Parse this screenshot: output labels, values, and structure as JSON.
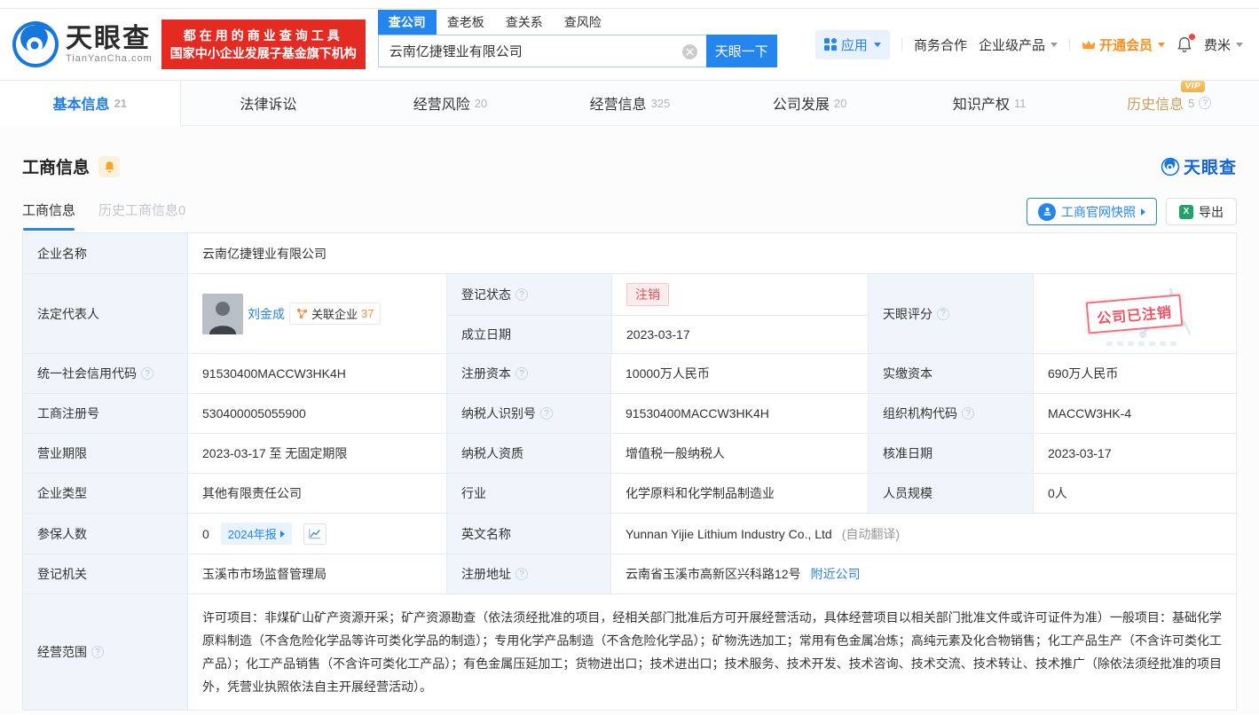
{
  "header": {
    "brand": "天眼查",
    "brand_domain": "TianYanCha.com",
    "slogan_line1": "都在用的商业查询工具",
    "slogan_line2": "国家中小企业发展子基金旗下机构",
    "search_tabs": [
      {
        "label": "查公司"
      },
      {
        "label": "查老板"
      },
      {
        "label": "查关系"
      },
      {
        "label": "查风险"
      }
    ],
    "search_value": "云南亿捷锂业有限公司",
    "search_button": "天眼一下",
    "nav_apps": "应用",
    "nav_cooperation": "商务合作",
    "nav_enterprise": "企业级产品",
    "nav_vip": "开通会员",
    "nav_user": "费米"
  },
  "tabs": [
    {
      "label": "基本信息",
      "count": "21"
    },
    {
      "label": "法律诉讼",
      "count": ""
    },
    {
      "label": "经营风险",
      "count": "20"
    },
    {
      "label": "经营信息",
      "count": "325"
    },
    {
      "label": "公司发展",
      "count": "20"
    },
    {
      "label": "知识产权",
      "count": "11"
    },
    {
      "label": "历史信息",
      "count": "5",
      "vip": "VIP"
    }
  ],
  "section": {
    "title": "工商信息",
    "subtab_current": "工商信息",
    "subtab_history": "历史工商信息0",
    "brand_watermark": "天眼查",
    "snapshot_button": "工商官网快照",
    "export_button": "导出"
  },
  "company": {
    "name_label": "企业名称",
    "name": "云南亿捷锂业有限公司",
    "legal_rep_label": "法定代表人",
    "legal_rep": "刘金成",
    "related_label": "关联企业",
    "related_count": "37",
    "status_label": "登记状态",
    "status": "注销",
    "established_label": "成立日期",
    "established": "2023-03-17",
    "score_label": "天眼评分",
    "stamp": "公司已注销"
  },
  "rows": [
    {
      "l1": "统一社会信用代码",
      "v1": "91530400MACCW3HK4H",
      "l2": "注册资本",
      "v2": "10000万人民币",
      "l3": "实缴资本",
      "v3": "690万人民币"
    },
    {
      "l1": "工商注册号",
      "v1": "530400005055900",
      "l2": "纳税人识别号",
      "v2": "91530400MACCW3HK4H",
      "l3": "组织机构代码",
      "v3": "MACCW3HK-4"
    },
    {
      "l1": "营业期限",
      "v1": "2023-03-17 至 无固定期限",
      "l2": "纳税人资质",
      "v2": "增值税一般纳税人",
      "l3": "核准日期",
      "v3": "2023-03-17"
    },
    {
      "l1": "企业类型",
      "v1": "其他有限责任公司",
      "l2": "行业",
      "v2": "化学原料和化学制品制造业",
      "l3": "人员规模",
      "v3": "0人"
    }
  ],
  "insured": {
    "label": "参保人数",
    "value": "0",
    "report_badge": "2024年报",
    "english_label": "英文名称",
    "english_name": "Yunnan Yijie Lithium Industry Co., Ltd",
    "english_note": "(自动翻译)"
  },
  "registry": {
    "label": "登记机关",
    "value": "玉溪市市场监督管理局",
    "address_label": "注册地址",
    "address": "云南省玉溪市高新区兴科路12号",
    "nearby_link": "附近公司"
  },
  "scope": {
    "label": "经营范围",
    "text": "许可项目：非煤矿山矿产资源开采；矿产资源勘查（依法须经批准的项目，经相关部门批准后方可开展经营活动，具体经营项目以相关部门批准文件或许可证件为准）一般项目：基础化学原料制造（不含危险化学品等许可类化学品的制造）；专用化学产品制造（不含危险化学品）；矿物洗选加工；常用有色金属冶炼；高纯元素及化合物销售；化工产品生产（不含许可类化工产品）；化工产品销售（不含许可类化工产品）；有色金属压延加工；货物进出口；技术进出口；技术服务、技术开发、技术咨询、技术交流、技术转让、技术推广（除依法须经批准的项目外，凭营业执照依法自主开展经营活动）。"
  }
}
